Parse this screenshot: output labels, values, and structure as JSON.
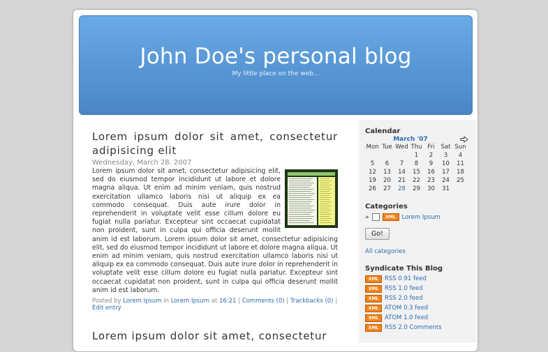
{
  "header": {
    "title": "John Doe's personal blog",
    "tagline": "My little place on the web..."
  },
  "post": {
    "title": "Lorem ipsum dolor sit amet, consectetur adipisicing elit",
    "date": "Wednesday, March 28. 2007",
    "body": "Lorem ipsum dolor sit amet, consectetur adipisicing elit, sed do eiusmod tempor incididunt ut labore et dolore magna aliqua. Ut enim ad minim veniam, quis nostrud exercitation ullamco laboris nisi ut aliquip ex ea commodo consequat. Duis aute irure dolor in reprehenderit in voluptate velit esse cillum dolore eu fugiat nulla pariatur. Excepteur sint occaecat cupidatat non proident, sunt in culpa qui officia deserunt mollit anim id est laborum. Lorem ipsum dolor sit amet, consectetur adipisicing elit, sed do eiusmod tempor incididunt ut labore et dolore magna aliqua. Ut enim ad minim veniam, quis nostrud exercitation ullamco laboris nisi ut aliquip ex ea commodo consequat. Duis aute irure dolor in reprehenderit in voluptate velit esse cillum dolore eu fugiat nulla pariatur. Excepteur sint occaecat cupidatat non proident, sunt in culpa qui officia deserunt mollit anim id est laborum.",
    "footer": {
      "posted_by": "Posted by",
      "author": "Lorem Ipsum",
      "in": "in",
      "category": "Lorem Ipsum",
      "at": "at",
      "time": "16:21",
      "comments": "Comments (0)",
      "trackbacks": "Trackbacks (0)",
      "edit": "Edit entry",
      "separator": "|"
    }
  },
  "post2": {
    "title": "Lorem ipsum dolor sit amet, consectetur"
  },
  "sidebar": {
    "calendar": {
      "heading": "Calendar",
      "month": "March '07",
      "days": [
        "Mon",
        "Tue",
        "Wed",
        "Thu",
        "Fri",
        "Sat",
        "Sun"
      ],
      "weeks": [
        [
          "",
          "",
          "",
          "1",
          "2",
          "3",
          "4"
        ],
        [
          "5",
          "6",
          "7",
          "8",
          "9",
          "10",
          "11"
        ],
        [
          "12",
          "13",
          "14",
          "15",
          "16",
          "17",
          "18"
        ],
        [
          "19",
          "20",
          "21",
          "22",
          "23",
          "24",
          "25"
        ],
        [
          "26",
          "27",
          "28",
          "29",
          "30",
          "31",
          ""
        ]
      ],
      "linked_day": "28"
    },
    "categories": {
      "heading": "Categories",
      "raquo": "»",
      "xml_badge": "XML",
      "item": "Lorem Ipsum",
      "go_label": "Go!",
      "all_label": "All categories"
    },
    "syndicate": {
      "heading": "Syndicate This Blog",
      "badge": "XML",
      "feeds": [
        "RSS 0.91 feed",
        "RSS 1.0 feed",
        "RSS 2.0 feed",
        "ATOM 0.3 feed",
        "ATOM 1.0 feed",
        "RSS 2.0 Comments"
      ]
    }
  },
  "colors": {
    "header_blue": "#5796d4",
    "link_blue": "#2a6bb0",
    "xml_orange": "#f3841b"
  }
}
